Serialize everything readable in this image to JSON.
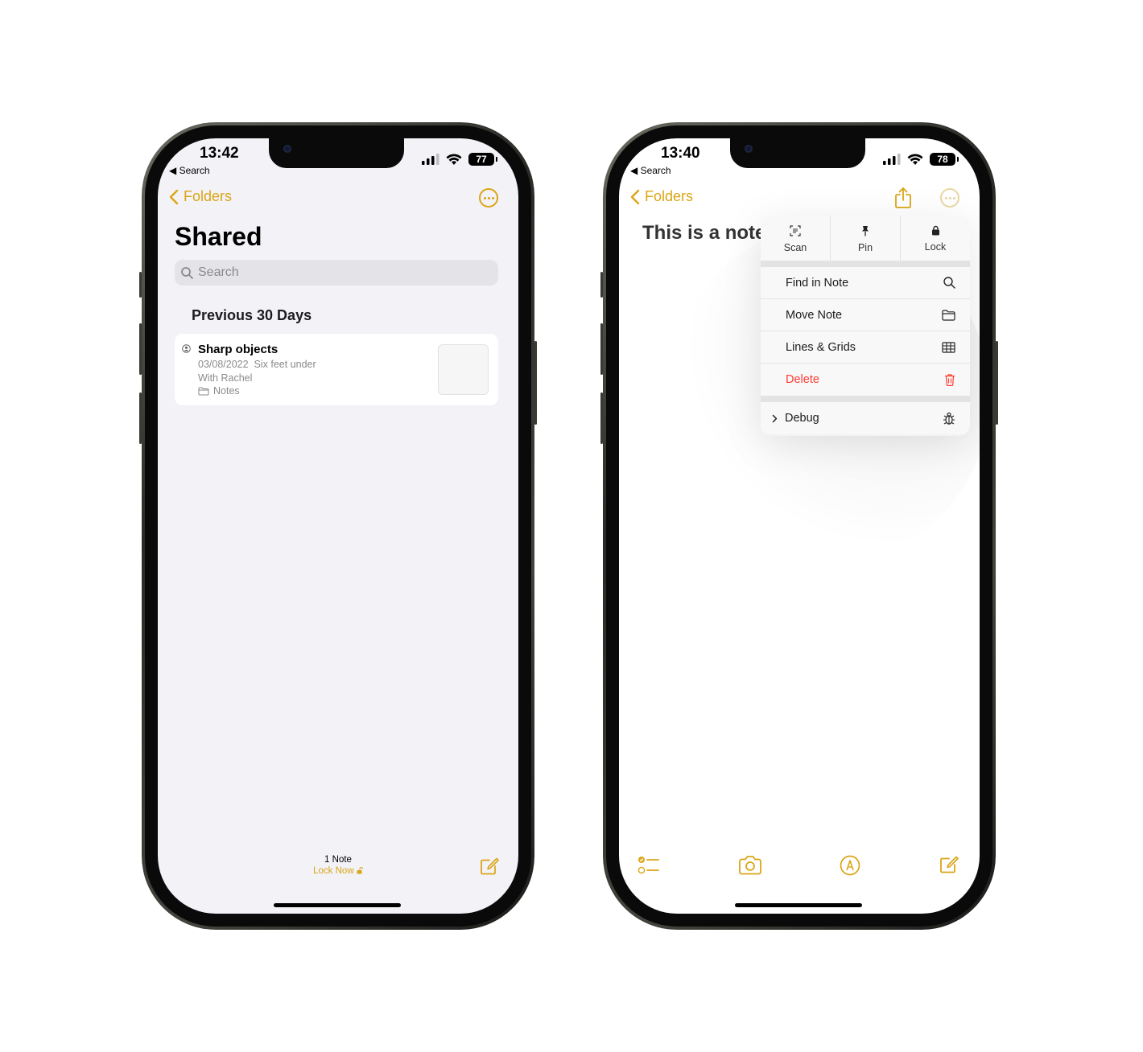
{
  "left_phone": {
    "status": {
      "time": "13:42",
      "back_label": "◀ Search",
      "battery": "77"
    },
    "nav": {
      "back_label": "Folders"
    },
    "title": "Shared",
    "search": {
      "placeholder": "Search"
    },
    "section_header": "Previous 30 Days",
    "note": {
      "title": "Sharp objects",
      "date": "03/08/2022",
      "preview": "Six feet under",
      "shared_with": "With Rachel",
      "folder": "Notes"
    },
    "footer": {
      "count": "1 Note",
      "lock_label": "Lock Now"
    }
  },
  "right_phone": {
    "status": {
      "time": "13:40",
      "back_label": "◀ Search",
      "battery": "78"
    },
    "nav": {
      "back_label": "Folders"
    },
    "note_title": "This is a note",
    "menu": {
      "top_actions": [
        {
          "label": "Scan",
          "icon": "scan-icon"
        },
        {
          "label": "Pin",
          "icon": "pin-icon"
        },
        {
          "label": "Lock",
          "icon": "lock-icon"
        }
      ],
      "items": [
        {
          "label": "Find in Note",
          "icon": "search-icon"
        },
        {
          "label": "Move Note",
          "icon": "folder-icon"
        },
        {
          "label": "Lines & Grids",
          "icon": "grid-icon"
        },
        {
          "label": "Delete",
          "icon": "trash-icon"
        }
      ],
      "debug_label": "Debug"
    }
  },
  "colors": {
    "accent": "#dba515",
    "destructive": "#ff3b30",
    "list_background": "#f2f2f7"
  }
}
